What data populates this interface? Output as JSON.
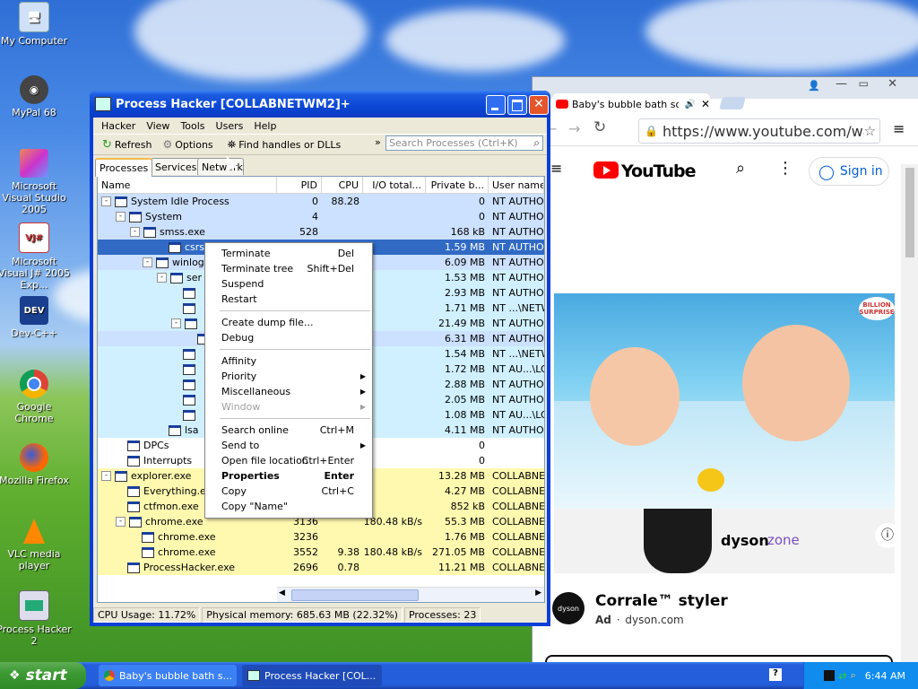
{
  "desktop": {
    "icons": [
      {
        "label": "My Computer"
      },
      {
        "label": "MyPal 68"
      },
      {
        "label": "Microsoft Visual Studio 2005"
      },
      {
        "label": "Microsoft Visual J# 2005 Exp..."
      },
      {
        "label": "Dev-C++"
      },
      {
        "label": "Google Chrome"
      },
      {
        "label": "Mozilla Firefox"
      },
      {
        "label": "VLC media player"
      },
      {
        "label": "Process Hacker 2"
      }
    ]
  },
  "browser": {
    "tab_title": "Baby's bubble bath song",
    "url": "https://www.youtube.com/watch?v",
    "youtube_label": "YouTube",
    "sign_in": "Sign in",
    "ad_brand": "dyson",
    "ad_product": "zone",
    "ad_title": "Corrale™ styler",
    "ad_label": "Ad",
    "ad_domain": "dyson.com",
    "video_badge": "BILLION SURPRISE"
  },
  "window": {
    "title": "Process Hacker [COLLABNETWM2]+",
    "menu": [
      "Hacker",
      "View",
      "Tools",
      "Users",
      "Help"
    ],
    "toolbar": {
      "refresh": "Refresh",
      "options": "Options",
      "find": "Find handles or DLLs",
      "search_placeholder": "Search Processes (Ctrl+K)"
    },
    "tabs": [
      "Processes",
      "Services",
      "Network"
    ],
    "columns": [
      "Name",
      "PID",
      "CPU",
      "I/O total...",
      "Private b...",
      "User name"
    ],
    "rows": [
      {
        "name": "System Idle Process",
        "pid": "0",
        "cpu": "88.28",
        "io": "",
        "priv": "0",
        "user": "NT AUTHOR"
      },
      {
        "name": "System",
        "pid": "4",
        "cpu": "",
        "io": "",
        "priv": "0",
        "user": "NT AUTHOR"
      },
      {
        "name": "smss.exe",
        "pid": "528",
        "cpu": "",
        "io": "",
        "priv": "168 kB",
        "user": "NT AUTHOR"
      },
      {
        "name": "csrss.",
        "pid": "",
        "cpu": "",
        "io": "",
        "priv": "1.59 MB",
        "user": "NT AUTHOR"
      },
      {
        "name": "winlog",
        "pid": "",
        "cpu": "",
        "io": "",
        "priv": "6.09 MB",
        "user": "NT AUTHOR"
      },
      {
        "name": "ser",
        "pid": "",
        "cpu": "",
        "io": "",
        "priv": "1.53 MB",
        "user": "NT AUTHOR"
      },
      {
        "name": "",
        "pid": "",
        "cpu": "",
        "io": "",
        "priv": "2.93 MB",
        "user": "NT AUTHOR"
      },
      {
        "name": "",
        "pid": "",
        "cpu": "",
        "io": "",
        "priv": "1.71 MB",
        "user": "NT ...\\NETW"
      },
      {
        "name": "",
        "pid": "",
        "cpu": "",
        "io": "",
        "priv": "21.49 MB",
        "user": "NT AUTHOR"
      },
      {
        "name": "",
        "pid": "",
        "cpu": "",
        "io": "",
        "priv": "6.31 MB",
        "user": "NT AUTHOR"
      },
      {
        "name": "",
        "pid": "",
        "cpu": "",
        "io": "",
        "priv": "1.54 MB",
        "user": "NT ...\\NETW"
      },
      {
        "name": "",
        "pid": "",
        "cpu": "",
        "io": "",
        "priv": "1.72 MB",
        "user": "NT AU...\\LO"
      },
      {
        "name": "",
        "pid": "",
        "cpu": "",
        "io": "",
        "priv": "2.88 MB",
        "user": "NT AUTHOR"
      },
      {
        "name": "",
        "pid": "",
        "cpu": "",
        "io": "",
        "priv": "2.05 MB",
        "user": "NT AUTHOR"
      },
      {
        "name": "",
        "pid": "",
        "cpu": "",
        "io": "",
        "priv": "1.08 MB",
        "user": "NT AU...\\LO"
      },
      {
        "name": "lsa",
        "pid": "",
        "cpu": "",
        "io": "",
        "priv": "4.11 MB",
        "user": "NT AUTHOR"
      },
      {
        "name": "DPCs",
        "pid": "",
        "cpu": "",
        "io": "",
        "priv": "0",
        "user": ""
      },
      {
        "name": "Interrupts",
        "pid": "",
        "cpu": "",
        "io": "",
        "priv": "0",
        "user": ""
      },
      {
        "name": "explorer.exe",
        "pid": "",
        "cpu": "",
        "io": "",
        "priv": "13.28 MB",
        "user": "COLLABNET"
      },
      {
        "name": "Everything.e",
        "pid": "",
        "cpu": "",
        "io": "",
        "priv": "4.27 MB",
        "user": "COLLABNET"
      },
      {
        "name": "ctfmon.exe",
        "pid": "",
        "cpu": "",
        "io": "",
        "priv": "852 kB",
        "user": "COLLABNET"
      },
      {
        "name": "chrome.exe",
        "pid": "3136",
        "cpu": "",
        "io": "180.48 kB/s",
        "priv": "55.3 MB",
        "user": "COLLABNET"
      },
      {
        "name": "chrome.exe",
        "pid": "3236",
        "cpu": "",
        "io": "",
        "priv": "1.76 MB",
        "user": "COLLABNET"
      },
      {
        "name": "chrome.exe",
        "pid": "3552",
        "cpu": "9.38",
        "io": "180.48 kB/s",
        "priv": "271.05 MB",
        "user": "COLLABNET"
      },
      {
        "name": "ProcessHacker.exe",
        "pid": "2696",
        "cpu": "0.78",
        "io": "",
        "priv": "11.21 MB",
        "user": "COLLABNET"
      }
    ],
    "status": {
      "cpu": "CPU Usage: 11.72%",
      "mem": "Physical memory: 685.63 MB (22.32%)",
      "procs": "Processes: 23"
    }
  },
  "context_menu": {
    "items": [
      {
        "label": "Terminate",
        "shortcut": "Del"
      },
      {
        "label": "Terminate tree",
        "shortcut": "Shift+Del"
      },
      {
        "label": "Suspend",
        "shortcut": ""
      },
      {
        "label": "Restart",
        "shortcut": ""
      },
      {
        "label": "Create dump file...",
        "shortcut": ""
      },
      {
        "label": "Debug",
        "shortcut": ""
      },
      {
        "label": "Affinity",
        "shortcut": ""
      },
      {
        "label": "Priority",
        "shortcut": ""
      },
      {
        "label": "Miscellaneous",
        "shortcut": ""
      },
      {
        "label": "Window",
        "shortcut": ""
      },
      {
        "label": "Search online",
        "shortcut": "Ctrl+M"
      },
      {
        "label": "Send to",
        "shortcut": ""
      },
      {
        "label": "Open file location",
        "shortcut": "Ctrl+Enter"
      },
      {
        "label": "Properties",
        "shortcut": "Enter"
      },
      {
        "label": "Copy",
        "shortcut": "Ctrl+C"
      },
      {
        "label": "Copy \"Name\"",
        "shortcut": ""
      }
    ]
  },
  "taskbar": {
    "start": "start",
    "tasks": [
      {
        "label": "Baby's bubble bath s..."
      },
      {
        "label": "Process Hacker [COL..."
      }
    ],
    "clock": "6:44 AM"
  },
  "colors": {
    "xp_blue": "#0a46d4",
    "sel_blue": "#316ac5",
    "system_row": "#cce0ff",
    "service_row": "#d0f0ff",
    "user_row": "#fff9b0"
  }
}
